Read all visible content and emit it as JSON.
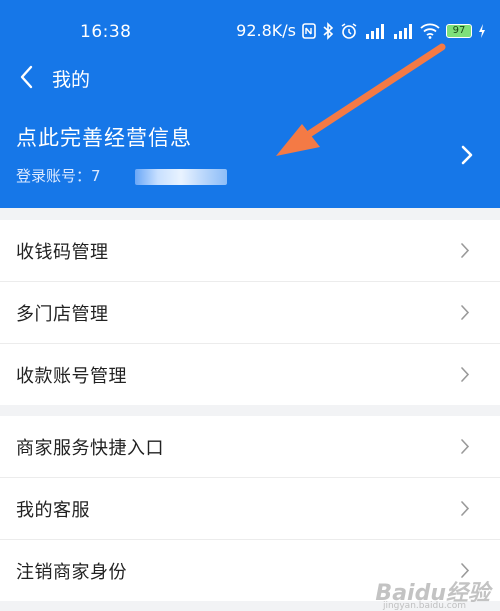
{
  "status_bar": {
    "time": "16:38",
    "network_speed": "92.8K/s",
    "battery_level": "97"
  },
  "nav": {
    "title": "我的"
  },
  "header": {
    "title": "点此完善经营信息",
    "account_label": "登录账号：",
    "account_value": "7"
  },
  "menu_group_1": {
    "items": [
      {
        "label": "收钱码管理"
      },
      {
        "label": "多门店管理"
      },
      {
        "label": "收款账号管理"
      }
    ]
  },
  "menu_group_2": {
    "items": [
      {
        "label": "商家服务快捷入口"
      },
      {
        "label": "我的客服"
      },
      {
        "label": "注销商家身份"
      }
    ]
  },
  "watermark": {
    "logo_text": "Baidu经验",
    "url": "jingyan.baidu.com"
  },
  "colors": {
    "primary_blue": "#1677e8",
    "annotation_orange": "#f47a45",
    "background": "#f2f3f5"
  }
}
